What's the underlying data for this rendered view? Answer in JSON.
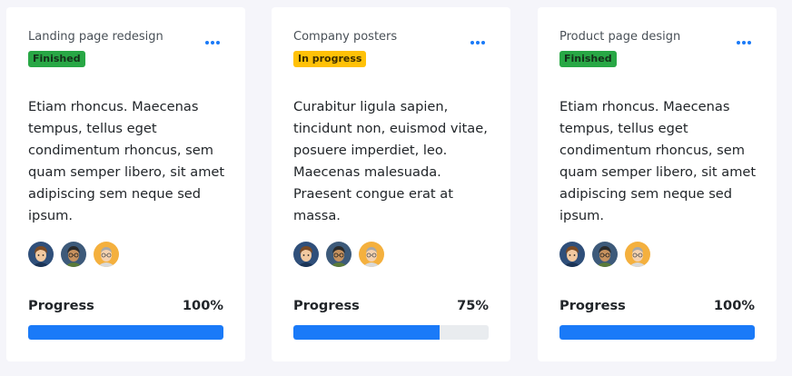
{
  "colors": {
    "accent": "#1a7af8",
    "finished": "#28a745",
    "in_progress": "#ffc107",
    "page_background": "#f5f5fa"
  },
  "cards": [
    {
      "title": "Landing page redesign",
      "status": "Finished",
      "description": "Etiam rhoncus. Maecenas tempus, tellus eget condimentum rhoncus, sem quam semper libero, sit amet adipiscing sem neque sed ipsum.",
      "progress_label": "Progress",
      "progress_value": "100%",
      "progress_fraction": 1.0,
      "avatars": [
        "avatar-brown-hair",
        "avatar-dark-hair-glasses",
        "avatar-grey-hair-glasses"
      ]
    },
    {
      "title": "Company posters",
      "status": "In progress",
      "description": "Curabitur ligula sapien, tincidunt non, euismod vitae, posuere imperdiet, leo. Maecenas malesuada. Praesent congue erat at massa.",
      "progress_label": "Progress",
      "progress_value": "75%",
      "progress_fraction": 0.75,
      "avatars": [
        "avatar-brown-hair",
        "avatar-dark-hair-glasses",
        "avatar-grey-hair-glasses"
      ]
    },
    {
      "title": "Product page design",
      "status": "Finished",
      "description": "Etiam rhoncus. Maecenas tempus, tellus eget condimentum rhoncus, sem quam semper libero, sit amet adipiscing sem neque sed ipsum.",
      "progress_label": "Progress",
      "progress_value": "100%",
      "progress_fraction": 1.0,
      "avatars": [
        "avatar-brown-hair",
        "avatar-dark-hair-glasses",
        "avatar-grey-hair-glasses"
      ]
    }
  ]
}
